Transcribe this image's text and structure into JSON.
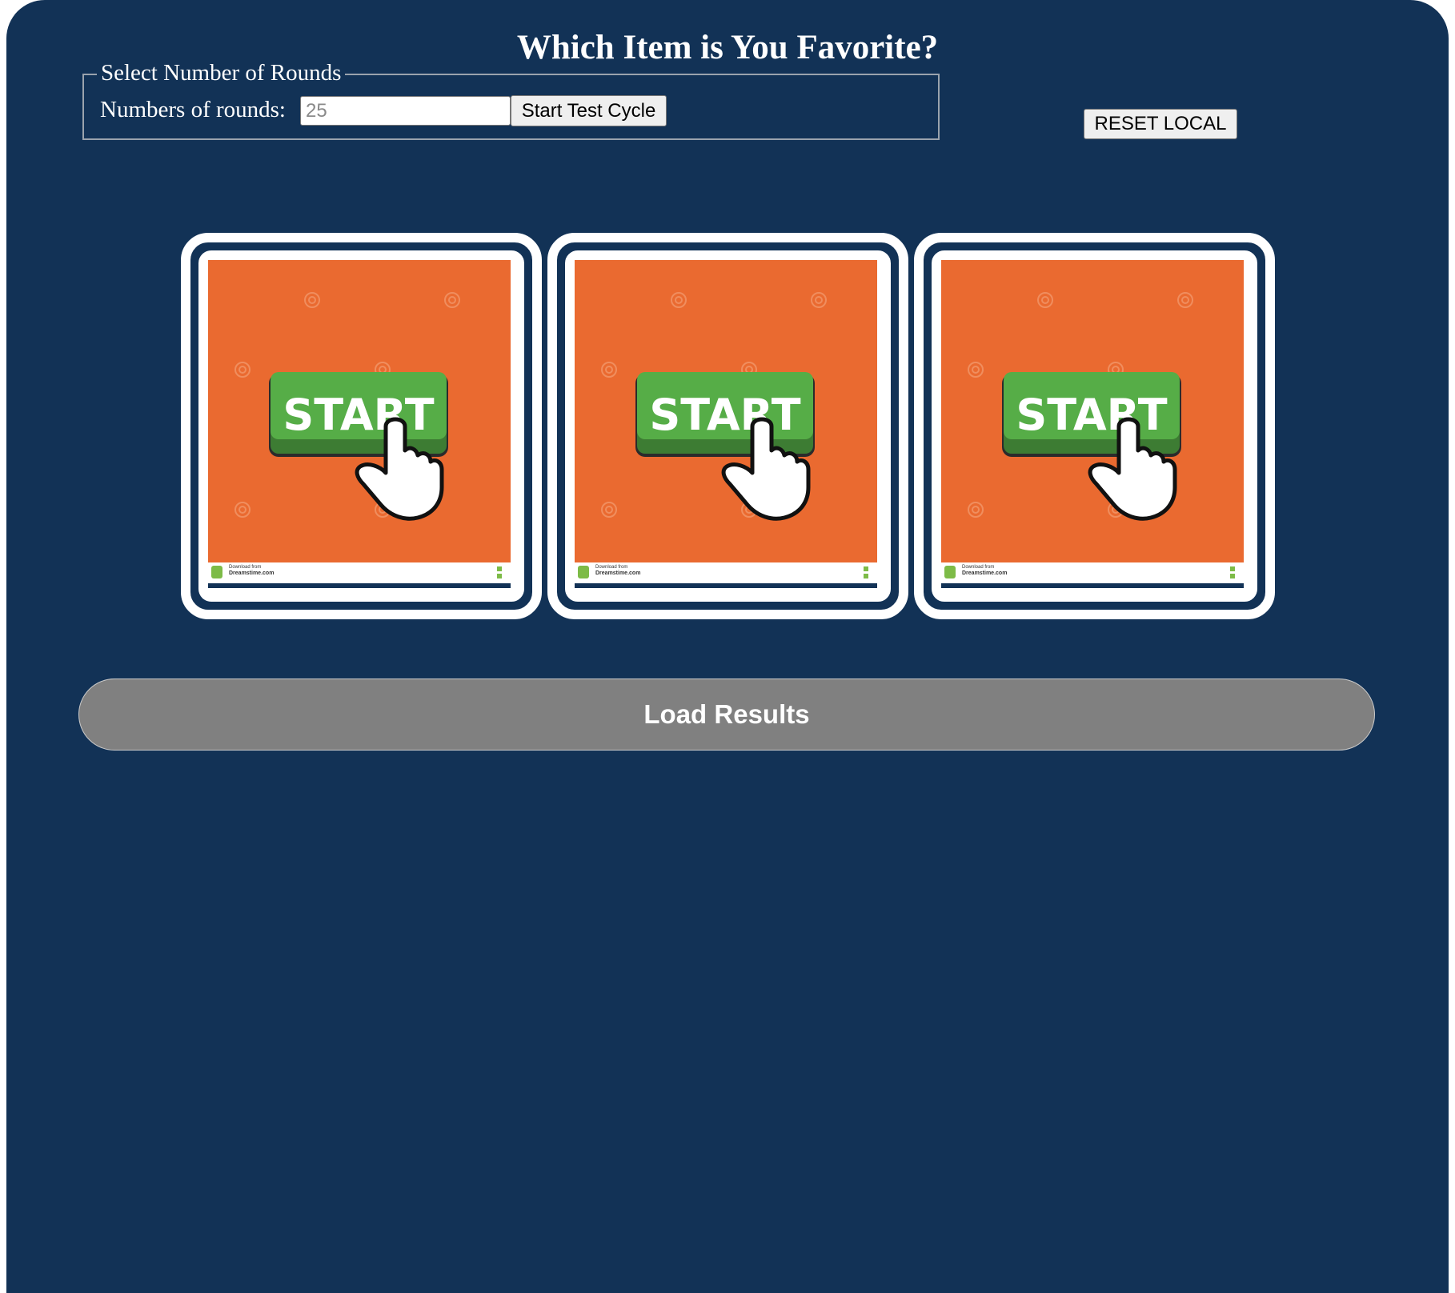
{
  "header": {
    "title": "Which Item is You Favorite?"
  },
  "rounds_form": {
    "legend": "Select Number of Rounds",
    "label": "Numbers of rounds:",
    "input_placeholder": "25",
    "input_value": "",
    "start_button_label": "Start Test Cycle"
  },
  "reset_button_label": "RESET LOCAL",
  "items": [
    {
      "button_text": "START",
      "credit_line1": "Download from",
      "credit_line2": "Dreamstime.com"
    },
    {
      "button_text": "START",
      "credit_line1": "Download from",
      "credit_line2": "Dreamstime.com"
    },
    {
      "button_text": "START",
      "credit_line1": "Download from",
      "credit_line2": "Dreamstime.com"
    }
  ],
  "load_results_label": "Load Results",
  "colors": {
    "background": "#123256",
    "image_orange": "#ea6a30",
    "start_green": "#56ad47",
    "load_button": "#808080"
  }
}
